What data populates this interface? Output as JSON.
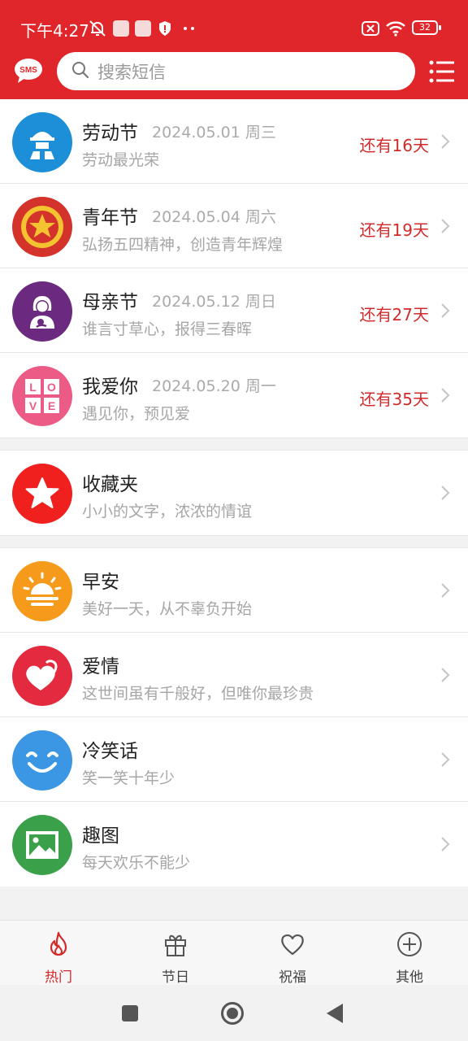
{
  "status_bar": {
    "time": "下午4:27",
    "battery": "32"
  },
  "header": {
    "logo_text": "SMS",
    "search_placeholder": "搜索短信",
    "accent_color": "#e0262a"
  },
  "festivals": [
    {
      "title": "劳动节",
      "date": "2024.05.01 周三",
      "subtitle": "劳动最光荣",
      "remaining": "还有16天",
      "icon": "worker-icon",
      "color": "#1c8fd8"
    },
    {
      "title": "青年节",
      "date": "2024.05.04 周六",
      "subtitle": "弘扬五四精神，创造青年辉煌",
      "remaining": "还有19天",
      "icon": "star-emblem-icon",
      "color": "#d3332b"
    },
    {
      "title": "母亲节",
      "date": "2024.05.12 周日",
      "subtitle": "谁言寸草心，报得三春晖",
      "remaining": "还有27天",
      "icon": "mother-icon",
      "color": "#6b2a80"
    },
    {
      "title": "我爱你",
      "date": "2024.05.20 周一",
      "subtitle": "遇见你，预见爱",
      "remaining": "还有35天",
      "icon": "love-blocks-icon",
      "color": "#ec5b86"
    }
  ],
  "favorites": {
    "title": "收藏夹",
    "subtitle": "小小的文字，浓浓的情谊",
    "icon": "star-icon",
    "color": "#f0201f"
  },
  "categories": [
    {
      "title": "早安",
      "subtitle": "美好一天，从不辜负开始",
      "icon": "sunrise-icon",
      "color": "#f59a1b"
    },
    {
      "title": "爱情",
      "subtitle": "这世间虽有千般好，但唯你最珍贵",
      "icon": "hearts-icon",
      "color": "#e32a3e"
    },
    {
      "title": "冷笑话",
      "subtitle": "笑一笑十年少",
      "icon": "smile-icon",
      "color": "#3b97e3"
    },
    {
      "title": "趣图",
      "subtitle": "每天欢乐不能少",
      "icon": "picture-icon",
      "color": "#3aa04a"
    }
  ],
  "tabs": [
    {
      "label": "热门",
      "icon": "flame-icon",
      "active": true
    },
    {
      "label": "节日",
      "icon": "gift-icon",
      "active": false
    },
    {
      "label": "祝福",
      "icon": "heart-outline-icon",
      "active": false
    },
    {
      "label": "其他",
      "icon": "plus-circle-icon",
      "active": false
    }
  ]
}
